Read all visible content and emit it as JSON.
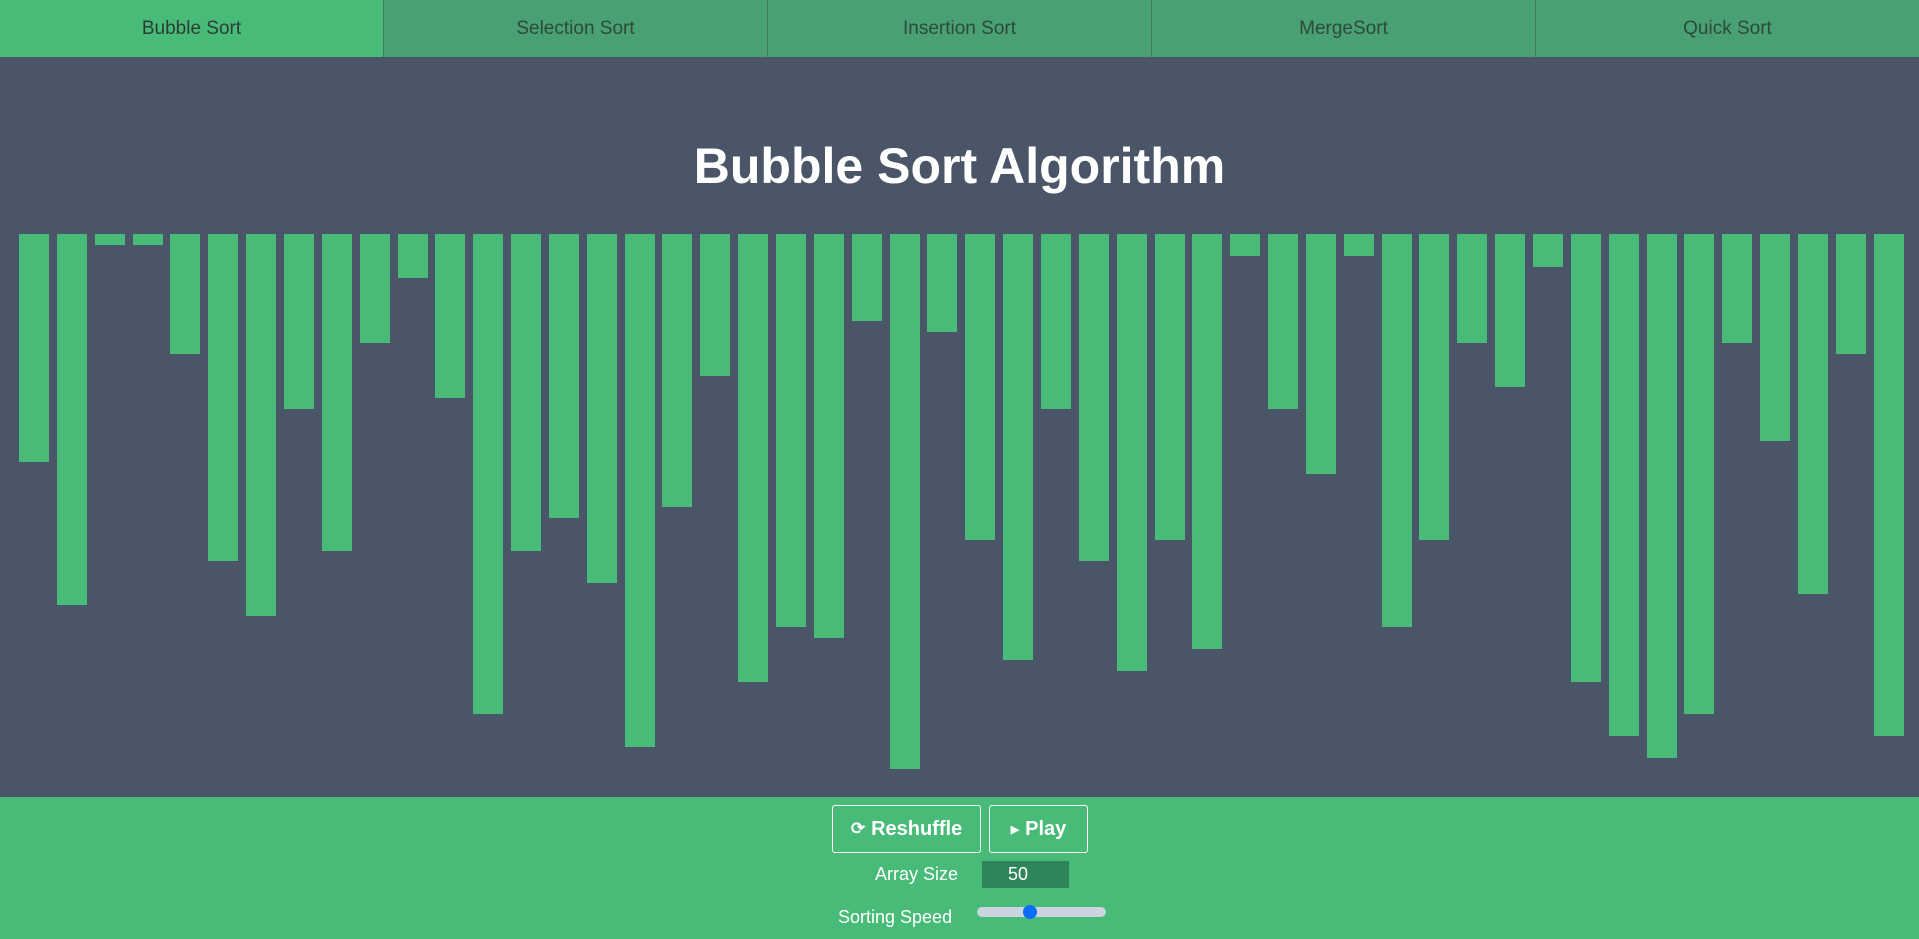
{
  "tabs": [
    {
      "label": "Bubble Sort",
      "active": true
    },
    {
      "label": "Selection Sort",
      "active": false
    },
    {
      "label": "Insertion Sort",
      "active": false
    },
    {
      "label": "MergeSort",
      "active": false
    },
    {
      "label": "Quick Sort",
      "active": false
    }
  ],
  "title": "Bubble Sort Algorithm",
  "bars": [
    228,
    371,
    11,
    11,
    120,
    327,
    382,
    175,
    317,
    109,
    44,
    164,
    480,
    317,
    284,
    349,
    513,
    273,
    142,
    448,
    393,
    404,
    87,
    535,
    98,
    306,
    426,
    175,
    327,
    437,
    306,
    415,
    22,
    175,
    240,
    22,
    393,
    306,
    109,
    153,
    33,
    448,
    502,
    524,
    480,
    109,
    207,
    360,
    120,
    502
  ],
  "colors": {
    "bar": "#48bb78",
    "background": "#4a5568",
    "accent": "#0d6efd"
  },
  "controls": {
    "reshuffle_label": "Reshuffle",
    "reshuffle_icon": "refresh-icon",
    "play_label": "Play",
    "play_icon": "play-icon",
    "array_size_label": "Array Size",
    "array_size_value": "50",
    "sorting_speed_label": "Sorting Speed",
    "sorting_speed_fraction": 0.4
  }
}
